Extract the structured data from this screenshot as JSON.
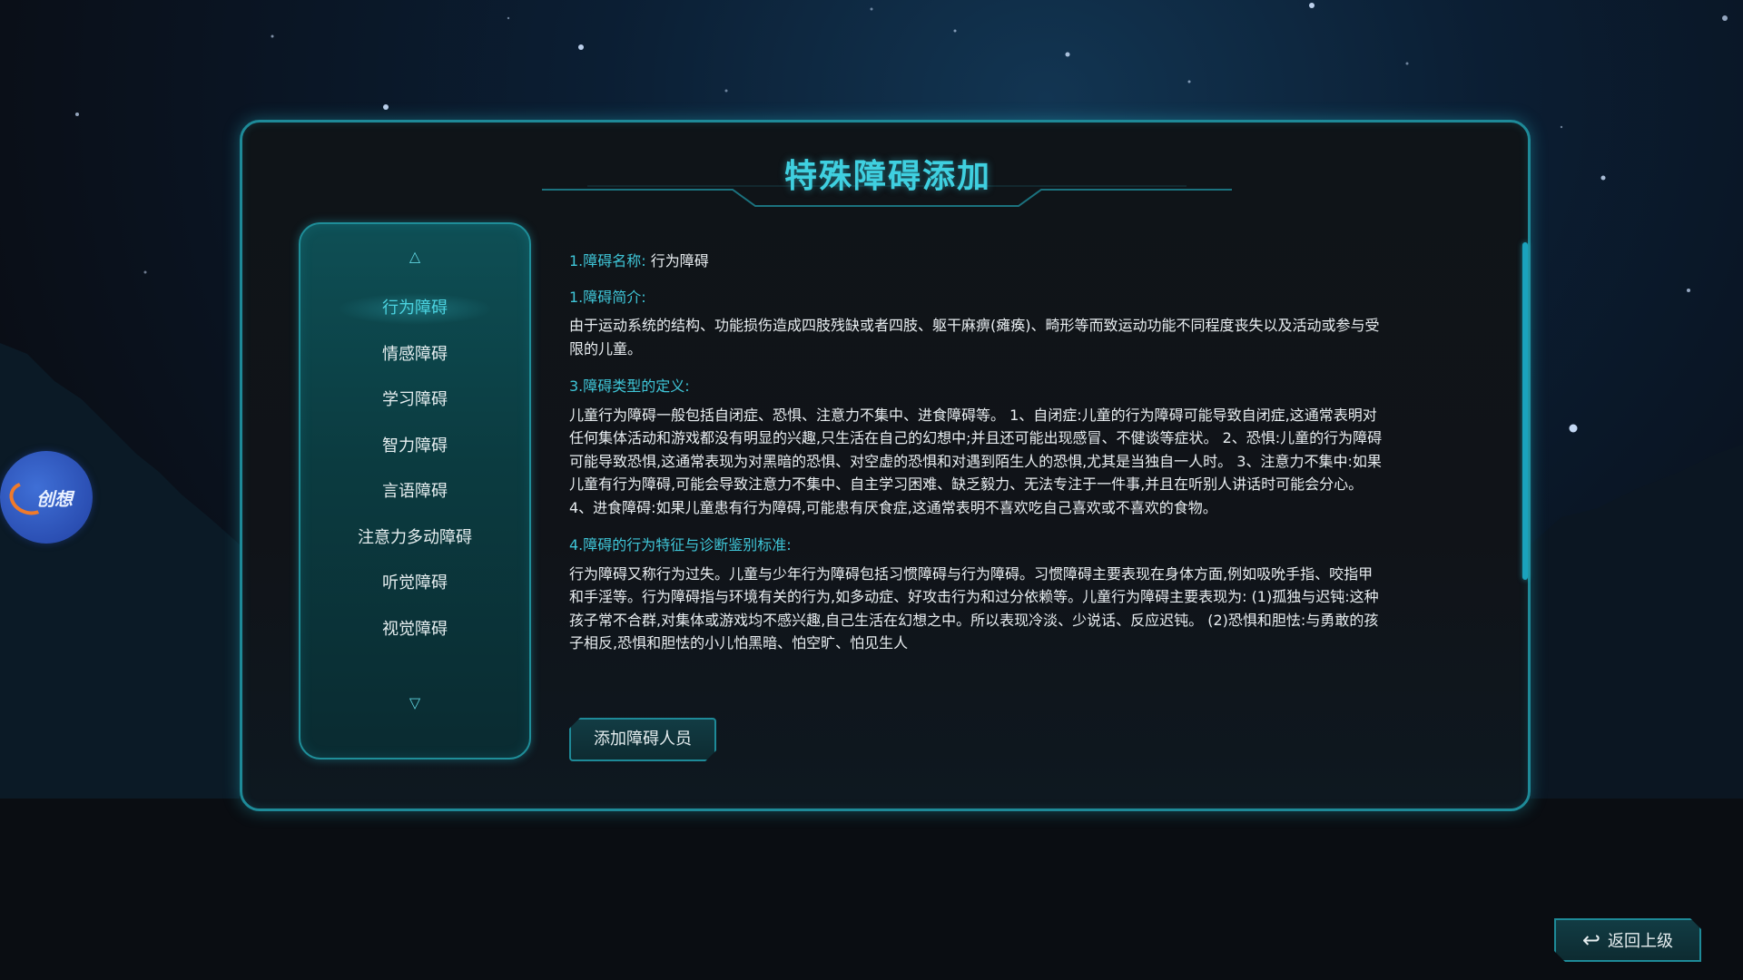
{
  "panel": {
    "title": "特殊障碍添加"
  },
  "logo": {
    "text": "创想"
  },
  "sidebar": {
    "up_icon": "triangle-up-icon",
    "down_icon": "triangle-down-icon",
    "active_index": 0,
    "items": [
      {
        "label": "行为障碍"
      },
      {
        "label": "情感障碍"
      },
      {
        "label": "学习障碍"
      },
      {
        "label": "智力障碍"
      },
      {
        "label": "言语障碍"
      },
      {
        "label": "注意力多动障碍"
      },
      {
        "label": "听觉障碍"
      },
      {
        "label": "视觉障碍"
      }
    ]
  },
  "content": {
    "name_label": "1.障碍名称:",
    "name_value": "行为障碍",
    "intro_heading": "1.障碍简介:",
    "intro_text": "由于运动系统的结构、功能损伤造成四肢残缺或者四肢、躯干麻痹(瘫痪)、畸形等而致运动功能不同程度丧失以及活动或参与受限的儿童。",
    "type_heading": "3.障碍类型的定义:",
    "type_text": "儿童行为障碍一般包括自闭症、恐惧、注意力不集中、进食障碍等。 1、自闭症:儿童的行为障碍可能导致自闭症,这通常表明对任何集体活动和游戏都没有明显的兴趣,只生活在自己的幻想中;并且还可能出现感冒、不健谈等症状。 2、恐惧:儿童的行为障碍可能导致恐惧,这通常表现为对黑暗的恐惧、对空虚的恐惧和对遇到陌生人的恐惧,尤其是当独自一人时。 3、注意力不集中:如果儿童有行为障碍,可能会导致注意力不集中、自主学习困难、缺乏毅力、无法专注于一件事,并且在听别人讲话时可能会分心。 4、进食障碍:如果儿童患有行为障碍,可能患有厌食症,这通常表明不喜欢吃自己喜欢或不喜欢的食物。",
    "feature_heading": "4.障碍的行为特征与诊断鉴别标准:",
    "feature_text": "行为障碍又称行为过失。儿童与少年行为障碍包括习惯障碍与行为障碍。习惯障碍主要表现在身体方面,例如吸吮手指、咬指甲和手淫等。行为障碍指与环境有关的行为,如多动症、好攻击行为和过分依赖等。儿童行为障碍主要表现为: (1)孤独与迟钝:这种孩子常不合群,对集体或游戏均不感兴趣,自己生活在幻想之中。所以表现冷淡、少说话、反应迟钝。 (2)恐惧和胆怯:与勇敢的孩子相反,恐惧和胆怯的小儿怕黑暗、怕空旷、怕见生人"
  },
  "actions": {
    "add_label": "添加障碍人员",
    "back_label": "返回上级",
    "back_icon": "return-arrow-icon"
  },
  "colors": {
    "accent": "#3fd0e0",
    "border": "#1e8a98",
    "panel_bg": "#101318"
  }
}
